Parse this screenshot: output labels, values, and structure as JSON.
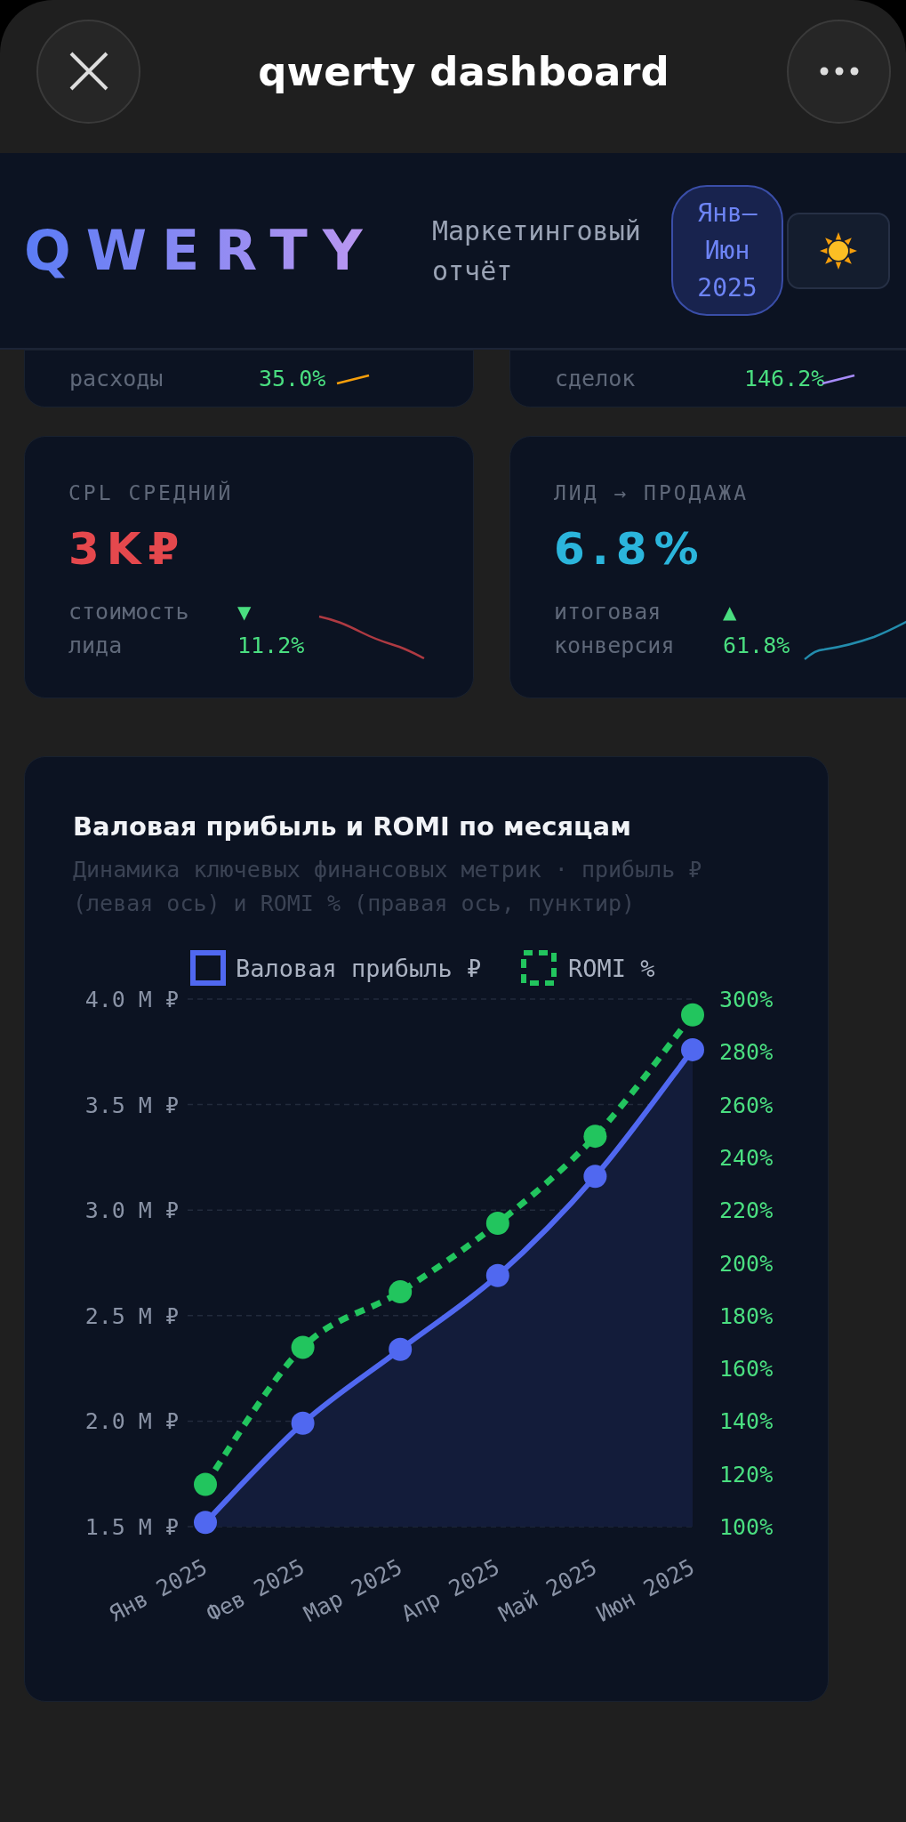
{
  "topbar": {
    "title": "qwerty dashboard"
  },
  "header": {
    "logo": "QWERTY",
    "subtitle": "Маркетинговый отчёт",
    "period": "Янв–Июн 2025"
  },
  "partial_cards": [
    {
      "caption": "расходы",
      "change": "35.0%",
      "color": "#f59e0b"
    },
    {
      "caption": "сделок",
      "change": "146.2%",
      "color": "#a78bfa"
    }
  ],
  "kpis": [
    {
      "label": "CPL СРЕДНИЙ",
      "value": "3K₽",
      "color": "#e5484d",
      "caption": "стоимость лида",
      "arrow": "▼",
      "change": "11.2%"
    },
    {
      "label": "ЛИД → ПРОДАЖА",
      "value": "6.8%",
      "color": "#2bb5dc",
      "caption": "итоговая конверсия",
      "arrow": "▲",
      "change": "61.8%"
    }
  ],
  "chart": {
    "title": "Валовая прибыль и ROMI по месяцам",
    "subtitle": "Динамика ключевых финансовых метрик · прибыль ₽ (левая ось) и ROMI % (правая ось, пунктир)",
    "chart_data": {
      "type": "line",
      "grid": true,
      "legend": true,
      "categories": [
        "Янв 2025",
        "Фев 2025",
        "Мар 2025",
        "Апр 2025",
        "Май 2025",
        "Июн 2025"
      ],
      "series": [
        {
          "name": "Валовая прибыль ₽",
          "color": "#5068f0",
          "type": "area",
          "marker": "circle",
          "line_style": "solid",
          "values": [
            1.52,
            1.99,
            2.34,
            2.69,
            3.16,
            3.76
          ]
        },
        {
          "name": "ROMI %",
          "color": "#22c55e",
          "type": "line",
          "axis": "y2",
          "marker": "circle",
          "line_style": "dashed",
          "values": [
            116,
            168,
            189,
            215,
            248,
            294
          ]
        }
      ],
      "ylim": [
        1.5,
        4.0
      ],
      "yticks": [
        {
          "value": 1.5,
          "label": "1.5 М ₽"
        },
        {
          "value": 2.0,
          "label": "2.0 М ₽"
        },
        {
          "value": 2.5,
          "label": "2.5 М ₽"
        },
        {
          "value": 3.0,
          "label": "3.0 М ₽"
        },
        {
          "value": 3.5,
          "label": "3.5 М ₽"
        },
        {
          "value": 4.0,
          "label": "4.0 М ₽"
        }
      ],
      "y2lim": [
        100,
        300
      ],
      "y2ticks": [
        {
          "value": 100,
          "label": "100%"
        },
        {
          "value": 120,
          "label": "120%"
        },
        {
          "value": 140,
          "label": "140%"
        },
        {
          "value": 160,
          "label": "160%"
        },
        {
          "value": 180,
          "label": "180%"
        },
        {
          "value": 200,
          "label": "200%"
        },
        {
          "value": 220,
          "label": "220%"
        },
        {
          "value": 240,
          "label": "240%"
        },
        {
          "value": 260,
          "label": "260%"
        },
        {
          "value": 280,
          "label": "280%"
        },
        {
          "value": 300,
          "label": "300%"
        }
      ]
    }
  }
}
